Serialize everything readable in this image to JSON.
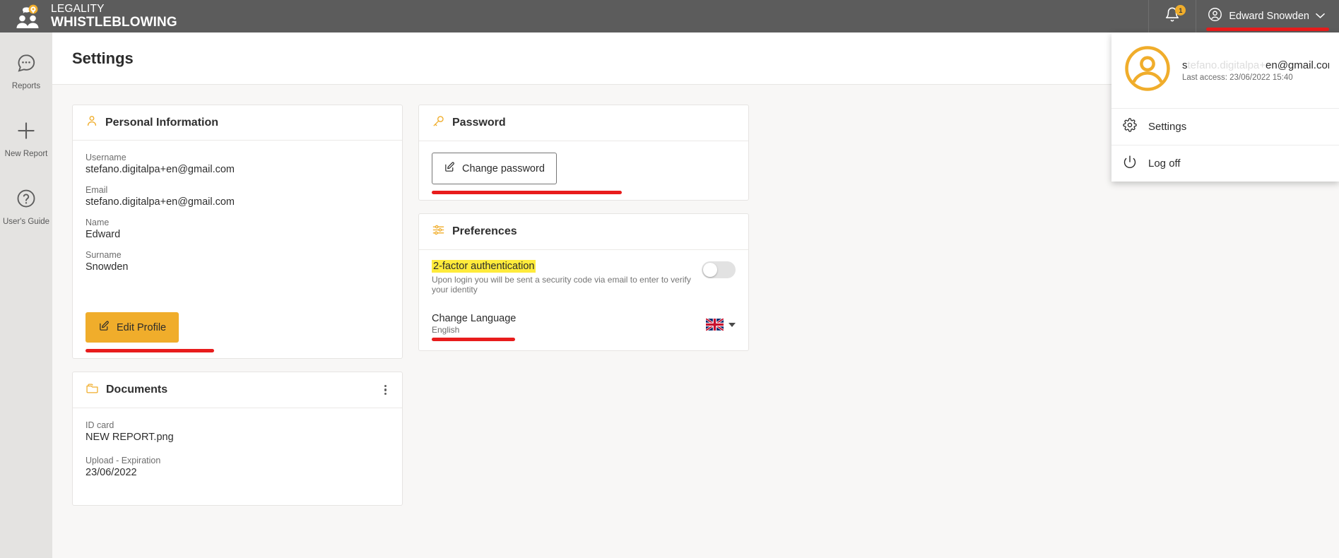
{
  "header": {
    "logo_line1": "LEGALITY",
    "logo_line2": "WHISTLEBLOWING",
    "notification_count": "1",
    "user_name": "Edward Snowden"
  },
  "sidebar": {
    "items": [
      {
        "label": "Reports",
        "icon": "chat-bubble-icon"
      },
      {
        "label": "New Report",
        "icon": "plus-icon"
      },
      {
        "label": "User's Guide",
        "icon": "question-circle-icon"
      }
    ]
  },
  "page": {
    "title": "Settings"
  },
  "personal_information": {
    "card_title": "Personal Information",
    "fields": [
      {
        "label": "Username",
        "value": "stefano.digitalpa+en@gmail.com"
      },
      {
        "label": "Email",
        "value": "stefano.digitalpa+en@gmail.com"
      },
      {
        "label": "Name",
        "value": "Edward"
      },
      {
        "label": "Surname",
        "value": "Snowden"
      }
    ],
    "edit_button": "Edit Profile"
  },
  "documents": {
    "card_title": "Documents",
    "fields": [
      {
        "label": "ID card",
        "value": "NEW REPORT.png"
      },
      {
        "label": "Upload - Expiration",
        "value": "23/06/2022"
      }
    ]
  },
  "password": {
    "card_title": "Password",
    "change_button": "Change password"
  },
  "preferences": {
    "card_title": "Preferences",
    "two_factor": {
      "title": "2-factor authentication",
      "description": "Upon login you will be sent a security code via email to enter to verify your identity",
      "enabled": "off"
    },
    "language": {
      "title": "Change Language",
      "value": "English",
      "flag": "uk-flag-icon"
    }
  },
  "user_dropdown": {
    "email_visible_start": "s",
    "email_faded": "tefano.digitalpa+",
    "email_visible_end": "en@gmail.com",
    "last_access": "Last access: 23/06/2022 15:40",
    "items": [
      {
        "label": "Settings",
        "icon": "gear-icon"
      },
      {
        "label": "Log off",
        "icon": "power-icon"
      }
    ]
  },
  "colors": {
    "header_bg": "#5c5c5c",
    "accent_orange": "#f0ad2b",
    "highlight_red": "#e81c1c",
    "highlight_yellow": "#ffeb3b"
  }
}
